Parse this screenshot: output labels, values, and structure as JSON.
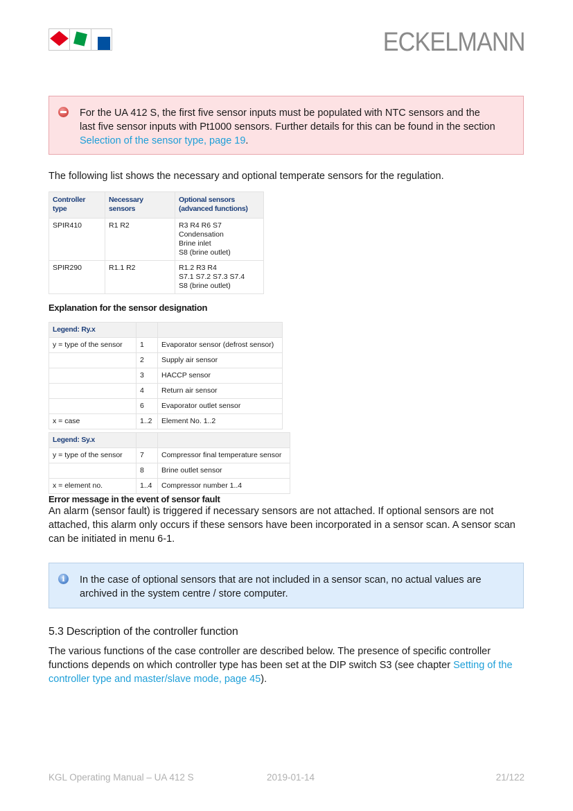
{
  "header": {
    "logo_icon": "eckelmann-logo-icon",
    "brand": "ECKELMANN"
  },
  "alert_danger": {
    "icon": "stop-icon",
    "text": "For the UA 412 S, the first five sensor inputs must be populated with NTC sensors and the last five sensor inputs with Pt1000 sensors. Further details for this can be found in the section ",
    "link": "Selection of the sensor type, page 19",
    "suffix": "."
  },
  "intro": "The following list shows the necessary and optional temperate sensors for the regulation.",
  "sensor_table": {
    "headers": [
      "Controller type",
      "Necessary sensors",
      "Optional sensors (advanced functions)"
    ],
    "rows": [
      {
        "type": "SPIR410",
        "necessary": "R1 R2",
        "optional": [
          "R3 R4 R6 S7",
          "Condensation",
          "Brine inlet",
          "S8 (brine outlet)"
        ]
      },
      {
        "type": "SPIR290",
        "necessary": "R1.1 R2",
        "optional": [
          "R1.2 R3 R4",
          "S7.1 S7.2 S7.3 S7.4",
          "S8 (brine outlet)"
        ]
      }
    ]
  },
  "designation_heading": "Explanation for the sensor designation",
  "legend_r": {
    "header": "Legend: Ry.x",
    "rows": [
      {
        "label": "y = type of the sensor",
        "code": "1",
        "desc": "Evaporator sensor (defrost sensor)"
      },
      {
        "label": "",
        "code": "2",
        "desc": "Supply air sensor"
      },
      {
        "label": "",
        "code": "3",
        "desc": "HACCP sensor"
      },
      {
        "label": "",
        "code": "4",
        "desc": "Return air sensor"
      },
      {
        "label": "",
        "code": "6",
        "desc": "Evaporator outlet sensor"
      },
      {
        "label": "x = case",
        "code": "1..2",
        "desc": "Element No. 1..2"
      }
    ]
  },
  "legend_s": {
    "header": "Legend: Sy.x",
    "rows": [
      {
        "label": "y = type of the sensor",
        "code": "7",
        "desc": "Compressor final temperature sensor"
      },
      {
        "label": "",
        "code": "8",
        "desc": "Brine outlet sensor"
      },
      {
        "label": "x = element no.",
        "code": "1..4",
        "desc": "Compressor number 1..4"
      }
    ]
  },
  "error_heading": "Error message in the event of sensor fault",
  "error_text": "An alarm (sensor fault) is triggered if necessary sensors are not attached. If optional sensors are not attached, this alarm only occurs if these sensors have been incorporated in a sensor scan. A sensor scan can be initiated in menu 6-1.",
  "alert_info": {
    "icon": "info-icon",
    "text": "In the case of optional sensors that are not included in a sensor scan, no actual values are archived in the system centre / store computer."
  },
  "section": {
    "title": "5.3 Description of the controller function",
    "text": "The various functions of the case controller are described below. The presence of specific controller functions depends on which controller type has been set at the DIP switch S3 (see chapter ",
    "link": "Setting of the controller type and master/slave mode, page 45",
    "suffix": ")."
  },
  "footer": {
    "doc": "KGL Operating Manual – UA 412 S",
    "date": "2019-01-14",
    "page": "21/122"
  }
}
